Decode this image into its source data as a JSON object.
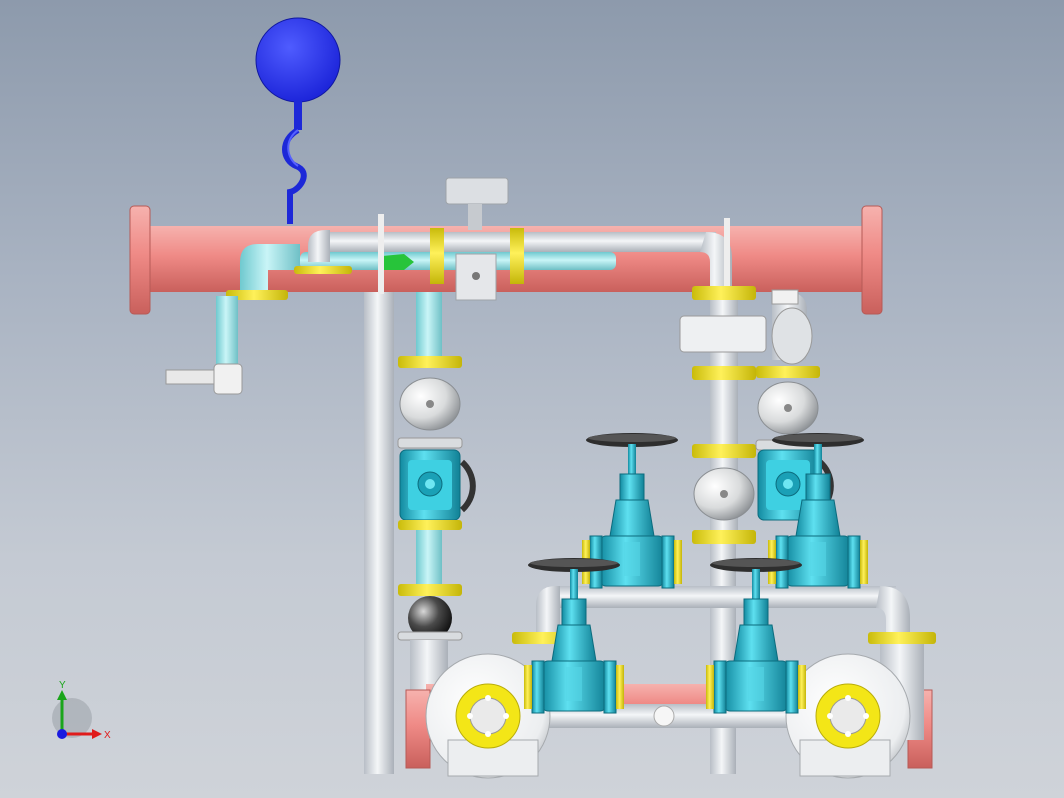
{
  "triad": {
    "x_label": "X",
    "y_label": "Y",
    "x_color": "#e01b1b",
    "y_color": "#1aa51a",
    "z_color": "#1a1ae0"
  },
  "colors": {
    "header_pipe": "#ef8a86",
    "header_flange": "#f4a6a2",
    "pipe": "#dfe4ea",
    "cyan_pipe": "#a5e8ec",
    "valve_body": "#2fc6dc",
    "valve_dark": "#128aa0",
    "flange_yellow": "#f2e51a",
    "tank_blue": "#1f2cf0",
    "handwheel": "#3a3a3a",
    "pump_white": "#f2f2f2"
  }
}
